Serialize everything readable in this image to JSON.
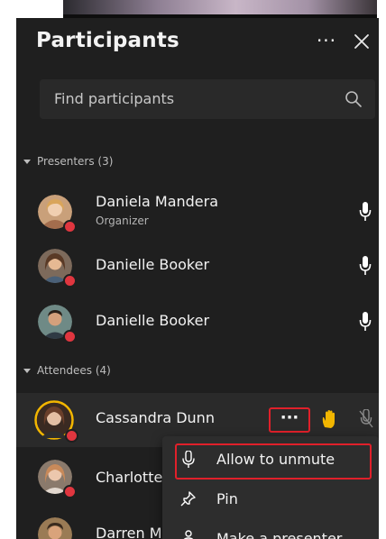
{
  "panel": {
    "title": "Participants",
    "more_label": "···"
  },
  "search": {
    "placeholder": "Find participants"
  },
  "sections": {
    "presenters": "Presenters (3)",
    "attendees": "Attendees (4)"
  },
  "presenters": [
    {
      "name": "Daniela Mandera",
      "role": "Organizer"
    },
    {
      "name": "Danielle Booker"
    },
    {
      "name": "Danielle Booker"
    }
  ],
  "attendees": [
    {
      "name": "Cassandra Dunn"
    },
    {
      "name": "Charlotte"
    },
    {
      "name": "Darren M"
    }
  ],
  "row_more_label": "···",
  "context_menu": {
    "items": [
      {
        "label": "Allow to unmute",
        "icon": "mic-icon"
      },
      {
        "label": "Pin",
        "icon": "pin-icon"
      },
      {
        "label": "Make a presenter",
        "icon": "presenter-icon"
      }
    ]
  },
  "colors": {
    "panel_bg": "#1f1f1f",
    "status_red": "#e0363f",
    "highlight_red": "#e0202a",
    "hand_yellow": "#f2b600"
  }
}
